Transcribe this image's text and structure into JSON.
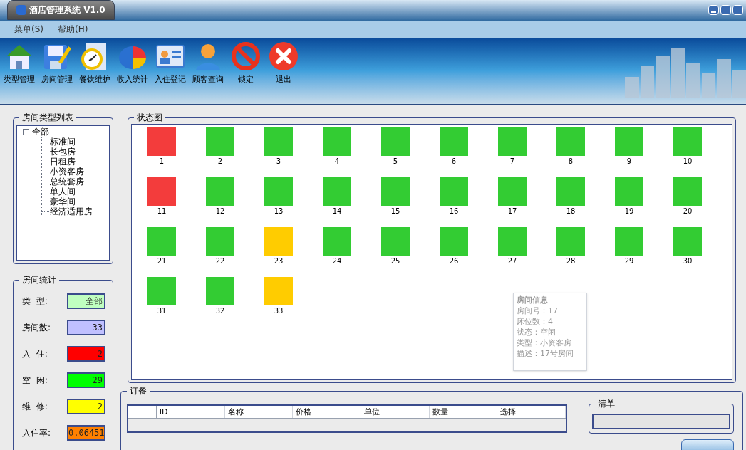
{
  "window": {
    "title": "酒店管理系统 V1.0"
  },
  "menu": [
    {
      "label": "菜单(S)"
    },
    {
      "label": "帮助(H)"
    }
  ],
  "toolbar": [
    {
      "label": "类型管理",
      "kind": "house"
    },
    {
      "label": "房间管理",
      "kind": "floppy"
    },
    {
      "label": "餐饮维护",
      "kind": "clock"
    },
    {
      "label": "收入统计",
      "kind": "pie"
    },
    {
      "label": "入住登记",
      "kind": "card"
    },
    {
      "label": "顾客查询",
      "kind": "person"
    },
    {
      "label": "锁定",
      "kind": "forbid"
    },
    {
      "label": "退出",
      "kind": "close"
    }
  ],
  "room_type_tree": {
    "title": "房间类型列表",
    "items": [
      {
        "label": "全部",
        "expanded": true,
        "children": [
          {
            "label": "标准间"
          },
          {
            "label": "长包房"
          },
          {
            "label": "日租房"
          },
          {
            "label": "小资客房"
          },
          {
            "label": "总统套房"
          },
          {
            "label": "单人间"
          },
          {
            "label": "豪华间"
          },
          {
            "label": "经济适用房"
          }
        ]
      }
    ]
  },
  "room_stats": {
    "title": "房间统计",
    "fields": [
      {
        "label": "类  型:",
        "value": "全部",
        "color": "#c0ffc0"
      },
      {
        "label": "房间数:",
        "value": "33",
        "color": "#c0c0ff"
      },
      {
        "label": "入  住:",
        "value": "2",
        "color": "#ff0000"
      },
      {
        "label": "空  闲:",
        "value": "29",
        "color": "#00ff00"
      },
      {
        "label": "维  修:",
        "value": "2",
        "color": "#ffff00"
      },
      {
        "label": "入住率:",
        "value": "0.06451",
        "color": "#ff8000"
      }
    ]
  },
  "status_map": {
    "title": "状态图",
    "rooms": [
      {
        "number": "1",
        "color": "#f33c3c"
      },
      {
        "number": "2",
        "color": "#33cc33"
      },
      {
        "number": "3",
        "color": "#33cc33"
      },
      {
        "number": "4",
        "color": "#33cc33"
      },
      {
        "number": "5",
        "color": "#33cc33"
      },
      {
        "number": "6",
        "color": "#33cc33"
      },
      {
        "number": "7",
        "color": "#33cc33"
      },
      {
        "number": "8",
        "color": "#33cc33"
      },
      {
        "number": "9",
        "color": "#33cc33"
      },
      {
        "number": "10",
        "color": "#33cc33"
      },
      {
        "number": "11",
        "color": "#f33c3c"
      },
      {
        "number": "12",
        "color": "#33cc33"
      },
      {
        "number": "13",
        "color": "#33cc33"
      },
      {
        "number": "14",
        "color": "#33cc33"
      },
      {
        "number": "15",
        "color": "#33cc33"
      },
      {
        "number": "16",
        "color": "#33cc33"
      },
      {
        "number": "17",
        "color": "#33cc33"
      },
      {
        "number": "18",
        "color": "#33cc33"
      },
      {
        "number": "19",
        "color": "#33cc33"
      },
      {
        "number": "20",
        "color": "#33cc33"
      },
      {
        "number": "21",
        "color": "#33cc33"
      },
      {
        "number": "22",
        "color": "#33cc33"
      },
      {
        "number": "23",
        "color": "#ffcc00"
      },
      {
        "number": "24",
        "color": "#33cc33"
      },
      {
        "number": "25",
        "color": "#33cc33"
      },
      {
        "number": "26",
        "color": "#33cc33"
      },
      {
        "number": "27",
        "color": "#33cc33"
      },
      {
        "number": "28",
        "color": "#33cc33"
      },
      {
        "number": "29",
        "color": "#33cc33"
      },
      {
        "number": "30",
        "color": "#33cc33"
      },
      {
        "number": "31",
        "color": "#33cc33"
      },
      {
        "number": "32",
        "color": "#33cc33"
      },
      {
        "number": "33",
        "color": "#ffcc00"
      }
    ],
    "tooltip": {
      "title": "房间信息",
      "lines": [
        "房间号：17",
        "床位数：4",
        "状态：空闲",
        "类型：小资客房",
        "描述：17号房间"
      ]
    }
  },
  "order": {
    "title": "订餐",
    "columns": [
      "ID",
      "名称",
      "价格",
      "单位",
      "数量",
      "选择"
    ],
    "list_title": "清单"
  }
}
